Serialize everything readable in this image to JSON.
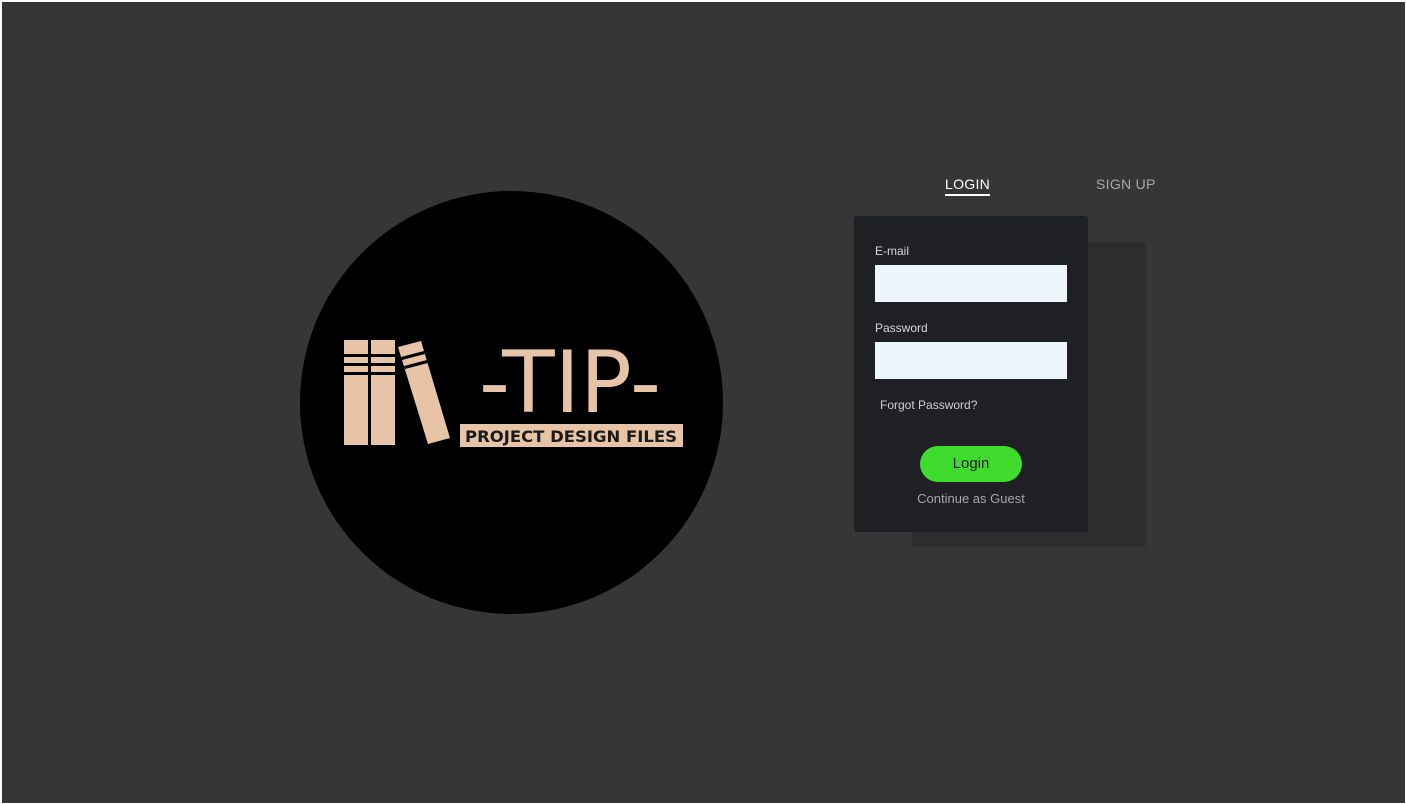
{
  "logo": {
    "brand": "-TIP-",
    "tagline": "PROJECT DESIGN FILES",
    "colors": {
      "circle": "#000000",
      "mark": "#e8c4a6"
    }
  },
  "tabs": {
    "login_label": "LOGIN",
    "signup_label": "SIGN UP",
    "active": "LOGIN"
  },
  "form": {
    "email_label": "E-mail",
    "email_value": "",
    "password_label": "Password",
    "password_value": "",
    "forgot_label": "Forgot Password?",
    "login_button": "Login",
    "guest_label": "Continue as Guest"
  },
  "colors": {
    "background": "#363636",
    "card": "#1f2023",
    "accent": "#3fdc2d",
    "input": "#eef6fd"
  }
}
